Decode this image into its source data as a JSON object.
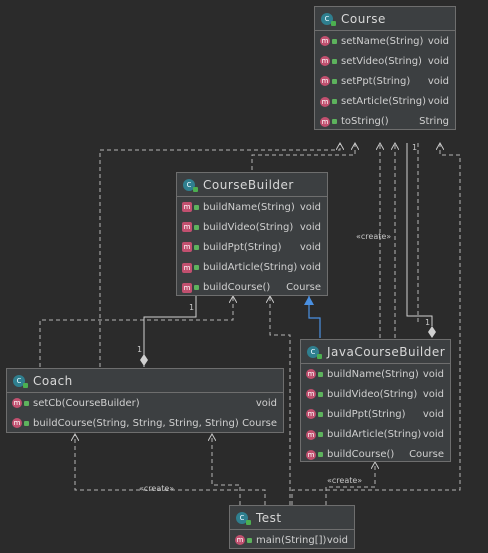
{
  "stereotype": "«create»",
  "ownership_label": "1",
  "classes": {
    "course": {
      "name": "Course",
      "methods": [
        {
          "name": "setName(String)",
          "type": "void"
        },
        {
          "name": "setVideo(String)",
          "type": "void"
        },
        {
          "name": "setPpt(String)",
          "type": "void"
        },
        {
          "name": "setArticle(String)",
          "type": "void"
        },
        {
          "name": "toString()",
          "type": "String"
        }
      ]
    },
    "course_builder": {
      "name": "CourseBuilder",
      "methods": [
        {
          "name": "buildName(String)",
          "type": "void"
        },
        {
          "name": "buildVideo(String)",
          "type": "void"
        },
        {
          "name": "buildPpt(String)",
          "type": "void"
        },
        {
          "name": "buildArticle(String)",
          "type": "void"
        },
        {
          "name": "buildCourse()",
          "type": "Course"
        }
      ]
    },
    "java_course_builder": {
      "name": "JavaCourseBuilder",
      "methods": [
        {
          "name": "buildName(String)",
          "type": "void"
        },
        {
          "name": "buildVideo(String)",
          "type": "void"
        },
        {
          "name": "buildPpt(String)",
          "type": "void"
        },
        {
          "name": "buildArticle(String)",
          "type": "void"
        },
        {
          "name": "buildCourse()",
          "type": "Course"
        }
      ]
    },
    "coach": {
      "name": "Coach",
      "methods": [
        {
          "name": "setCb(CourseBuilder)",
          "type": "void"
        },
        {
          "name": "buildCourse(String, String, String, String)",
          "type": "Course"
        }
      ]
    },
    "test": {
      "name": "Test",
      "methods": [
        {
          "name": "main(String[])",
          "type": "void"
        }
      ]
    }
  }
}
